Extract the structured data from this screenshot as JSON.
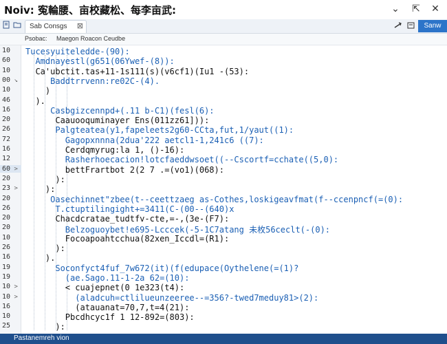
{
  "window": {
    "title": "Noiv: 寃輪腰、亩校藏松、每李亩武:",
    "controls": [
      "⌄",
      "⇱",
      "✕"
    ]
  },
  "toolbar": {
    "tab_label": "Sab Consgs",
    "tab_close": "⊠",
    "save_label": "Sanw"
  },
  "breadcrumb": {
    "label": "Psobac:",
    "value": "Maegon Roacon Ceudbe"
  },
  "gutter": {
    "lines": [
      {
        "n": "10",
        "fold": ""
      },
      {
        "n": "60",
        "fold": ""
      },
      {
        "n": "10",
        "fold": ""
      },
      {
        "n": "00",
        "fold": "↘"
      },
      {
        "n": "10",
        "fold": ""
      },
      {
        "n": "46",
        "fold": ""
      },
      {
        "n": "16",
        "fold": ""
      },
      {
        "n": "20",
        "fold": ""
      },
      {
        "n": "26",
        "fold": ""
      },
      {
        "n": "72",
        "fold": ""
      },
      {
        "n": "16",
        "fold": ""
      },
      {
        "n": "12",
        "fold": ""
      },
      {
        "n": "60",
        "fold": ">"
      },
      {
        "n": "20",
        "fold": ""
      },
      {
        "n": "23",
        "fold": ">"
      },
      {
        "n": "20",
        "fold": ""
      },
      {
        "n": "26",
        "fold": ""
      },
      {
        "n": "20",
        "fold": ""
      },
      {
        "n": "20",
        "fold": ""
      },
      {
        "n": "10",
        "fold": ""
      },
      {
        "n": "26",
        "fold": ""
      },
      {
        "n": "16",
        "fold": ""
      },
      {
        "n": "19",
        "fold": ""
      },
      {
        "n": "19",
        "fold": ""
      },
      {
        "n": "10",
        "fold": ">"
      },
      {
        "n": "10",
        "fold": ">"
      },
      {
        "n": "16",
        "fold": ""
      },
      {
        "n": "10",
        "fold": ""
      },
      {
        "n": "25",
        "fold": ""
      }
    ]
  },
  "code": [
    "Tucesyuiteledde-(90):",
    "  Amdnayestl(g651(06Ywef-(8)):",
    "  Ca'ubctit.tas+11-1s111(s)(v6cf1)(Iu1 -(53):",
    "     Baddtrrvenn:re02C-(4).",
    "    )",
    "  ).",
    "     Casbgizcennpd+(.11 b-C1)(fesl(6):",
    "      Caauooquminayer Ens(011zz61])):",
    "      Palgteatea(y1,fapeleets2g60-CCta,fut,1/yaut((1):",
    "        Gagopxnnna(2dua'222 aetcl1-1,241c6 ((7):",
    "        Cerdqmyrug:la 1, ()-16):",
    "        Rasherhoecacion!lotcfaeddwsoet((--Cscortf=cchate((5,0):",
    "        bettFrartbot 2(2 7 .=(vo1)(068):",
    "      ):",
    "    ):",
    "     Oasechinnet\"zbee(t--ceettzaeg as-Cothes,loskigeavfmat(f--ccenpncf(=(0):",
    "      T.ctuptilingight+=3411(C-(00--(640)x",
    "      Chacdcratae_tudtfv-cte,=-,(3e-(F7):",
    "        Belzoguoybet!e695-Lcccek(-5-1C7atang 未枚56ceclt(-(0):",
    "        Focoapoahtcchua(82xen_Iccdl=(R1):",
    "      ):",
    "    ).",
    "      Soconfyct4fuf_7w672(it)(f(edupace(Oythelene(=(1)?",
    "        (ae.Sago.11-1-2a 62=(10):",
    "        < cuajepnet(0 1e323(t4):",
    "          (aladcuh=ctlilueunzeeree--=356?-twed7meduy81>(2):",
    "          (atauanat=70,7,t=4(21):",
    "        Pbcdhcyc1f 1 12-892=(803):",
    "      ):"
  ],
  "status": {
    "text": "Pastanemreh vion"
  },
  "colors": {
    "accent": "#2c74c9",
    "status_bar": "#1f4f8c",
    "code_blue": "#1a5fb4"
  }
}
